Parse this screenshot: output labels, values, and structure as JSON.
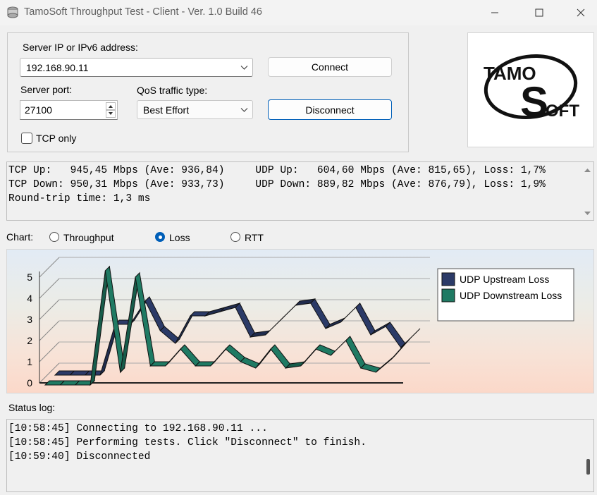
{
  "window": {
    "title": "TamoSoft Throughput Test - Client - Ver. 1.0 Build 46"
  },
  "connection": {
    "server_label": "Server IP or IPv6  address:",
    "server_value": "192.168.90.11",
    "port_label": "Server port:",
    "port_value": "27100",
    "qos_label": "QoS traffic type:",
    "qos_value": "Best Effort",
    "tcp_only_label": "TCP only",
    "tcp_only_checked": false,
    "connect_label": "Connect",
    "disconnect_label": "Disconnect"
  },
  "logo": {
    "text_tamo": "TAMO",
    "text_s": "S",
    "text_oft": "OFT"
  },
  "results": {
    "line1": "TCP Up:   945,45 Mbps (Ave: 936,84)     UDP Up:   604,60 Mbps (Ave: 815,65), Loss: 1,7%",
    "line2": "TCP Down: 950,31 Mbps (Ave: 933,73)     UDP Down: 889,82 Mbps (Ave: 876,79), Loss: 1,9%",
    "line3": "Round-trip time: 1,3 ms"
  },
  "chart_selector": {
    "label": "Chart:",
    "options": [
      "Throughput",
      "Loss",
      "RTT"
    ],
    "selected": "Loss"
  },
  "chart_data": {
    "type": "line",
    "y_ticks": [
      "0",
      "1",
      "2",
      "3",
      "4",
      "5"
    ],
    "ylim": [
      0,
      5
    ],
    "grid": true,
    "legend_position": "top-right",
    "series": [
      {
        "name": "UDP Upstream Loss",
        "color": "#2b3a67",
        "values": [
          0.1,
          0.1,
          0.1,
          0.1,
          2.5,
          2.5,
          3.6,
          2.2,
          1.6,
          2.9,
          2.9,
          3.1,
          3.3,
          1.9,
          2.0,
          2.7,
          3.4,
          3.5,
          2.3,
          2.6,
          3.3,
          2.0,
          2.4,
          1.4,
          2.1
        ]
      },
      {
        "name": "UDP Downstream Loss",
        "color": "#1f7a63",
        "values": [
          0.1,
          0.1,
          0.1,
          0.1,
          5.5,
          0.7,
          5.2,
          1.0,
          1.0,
          1.8,
          1.0,
          1.0,
          1.8,
          1.2,
          0.9,
          1.8,
          0.9,
          1.0,
          1.8,
          1.5,
          2.2,
          0.9,
          0.7,
          1.3,
          2.1
        ]
      }
    ]
  },
  "status_log": {
    "label": "Status log:",
    "lines": [
      "[10:58:45] Connecting to 192.168.90.11 ...",
      "[10:58:45] Performing tests. Click \"Disconnect\" to finish.",
      "[10:59:40] Disconnected"
    ]
  },
  "colors": {
    "accent": "#005fb8",
    "upstream": "#2b3a67",
    "downstream": "#1f7a63"
  }
}
